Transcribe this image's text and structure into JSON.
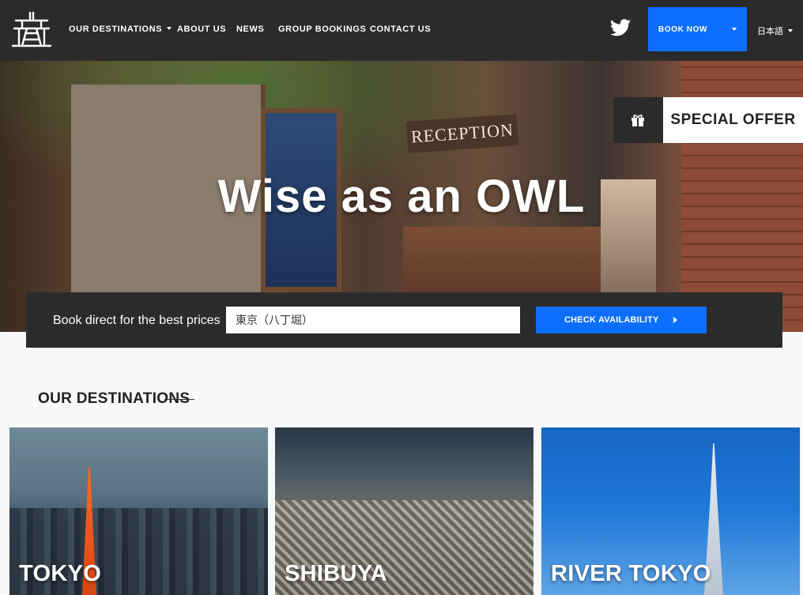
{
  "nav": {
    "items": [
      {
        "label": "OUR DESTINATIONS",
        "has_dropdown": true
      },
      {
        "label": "ABOUT US",
        "has_dropdown": false
      },
      {
        "label": "NEWS",
        "has_dropdown": false
      },
      {
        "label": "GROUP BOOKINGS",
        "has_dropdown": false
      },
      {
        "label": "CONTACT US",
        "has_dropdown": false
      }
    ],
    "book_now": "BOOK NOW",
    "language": "日本語",
    "social_icon": "twitter-icon",
    "logo_icon": "castle-logo-icon"
  },
  "hero": {
    "title": "Wise as an OWL",
    "sign_text": "RECEPTION",
    "special_offer": "SPECIAL OFFER",
    "offer_icon": "gift-icon"
  },
  "booking": {
    "label": "Book direct for the best prices",
    "location_value": "東京（八丁堀）",
    "check_button": "CHECK AVAILABILITY"
  },
  "destinations": {
    "heading": "OUR DESTINATIONS",
    "cards": [
      {
        "label": "TOKYO"
      },
      {
        "label": "SHIBUYA"
      },
      {
        "label": "RIVER TOKYO"
      }
    ]
  },
  "colors": {
    "nav_bg": "#2b2b2b",
    "accent_blue": "#0d6efd",
    "page_bg": "#f7f8fa"
  }
}
